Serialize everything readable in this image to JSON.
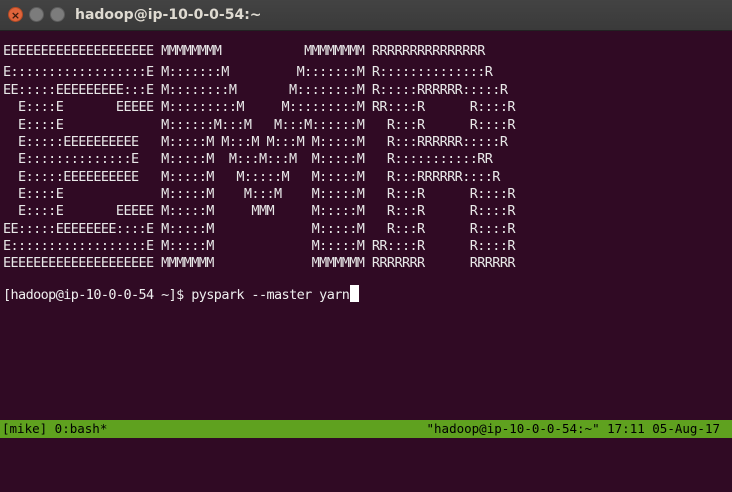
{
  "window": {
    "title": "hadoop@ip-10-0-0-54:~",
    "close_glyph": "×",
    "min_glyph": "",
    "max_glyph": ""
  },
  "terminal": {
    "banner": [
      "EEEEEEEEEEEEEEEEEEEE MMMMMMMM           MMMMMMMM RRRRRRRRRRRRRRR",
      "E::::::::::::::::::E M:::::::M         M:::::::M R::::::::::::::R",
      "EE:::::EEEEEEEEE:::E M::::::::M       M::::::::M R:::::RRRRRR:::::R",
      "  E::::E       EEEEE M:::::::::M     M:::::::::M RR::::R      R::::R",
      "  E::::E             M::::::M:::M   M:::M::::::M   R:::R      R::::R",
      "  E:::::EEEEEEEEEE   M:::::M M:::M M:::M M:::::M   R:::RRRRRR:::::R",
      "  E::::::::::::::E   M:::::M  M:::M:::M  M:::::M   R:::::::::::RR",
      "  E:::::EEEEEEEEEE   M:::::M   M:::::M   M:::::M   R:::RRRRRR::::R",
      "  E::::E             M:::::M    M:::M    M:::::M   R:::R      R::::R",
      "  E::::E       EEEEE M:::::M     MMM     M:::::M   R:::R      R::::R",
      "EE:::::EEEEEEEE::::E M:::::M             M:::::M   R:::R      R::::R",
      "E::::::::::::::::::E M:::::M             M:::::M RR::::R      R::::R",
      "EEEEEEEEEEEEEEEEEEEE MMMMMMM             MMMMMMM RRRRRRR      RRRRRR"
    ],
    "prompt": "[hadoop@ip-10-0-0-54 ~]$ ",
    "command": "pyspark --master yarn"
  },
  "statusbar": {
    "left": "[mike] 0:bash*",
    "right": "\"hadoop@ip-10-0-0-54:~\" 17:11 05-Aug-17",
    "color": "#5fa11f"
  },
  "colors": {
    "background": "#300a24",
    "text": "#e8e8e8"
  }
}
